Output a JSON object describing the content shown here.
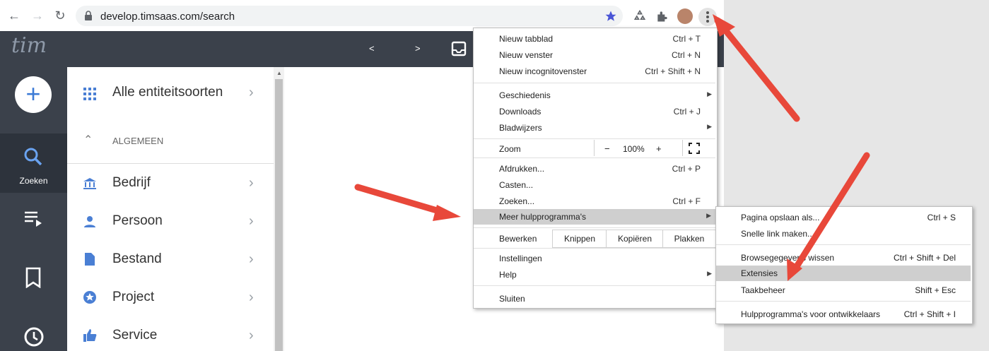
{
  "browser": {
    "url": "develop.timsaas.com/search",
    "nav": {
      "back": "←",
      "forward": "→",
      "reload": "↻"
    }
  },
  "app": {
    "logo": "tim",
    "prev": "<",
    "next": ">",
    "rail": {
      "add": "+",
      "search_label": "Zoeken"
    },
    "panel": {
      "all_types": "Alle entiteitsoorten",
      "section": "ALGEMEEN",
      "items": [
        "Bedrijf",
        "Persoon",
        "Bestand",
        "Project",
        "Service"
      ]
    }
  },
  "menu": {
    "items": [
      {
        "label": "Nieuw tabblad",
        "shortcut": "Ctrl + T"
      },
      {
        "label": "Nieuw venster",
        "shortcut": "Ctrl + N"
      },
      {
        "label": "Nieuw incognitovenster",
        "shortcut": "Ctrl + Shift + N"
      },
      {
        "label": "Geschiedenis",
        "shortcut": ""
      },
      {
        "label": "Downloads",
        "shortcut": "Ctrl + J"
      },
      {
        "label": "Bladwijzers",
        "shortcut": ""
      },
      {
        "label": "Afdrukken...",
        "shortcut": "Ctrl + P"
      },
      {
        "label": "Casten...",
        "shortcut": ""
      },
      {
        "label": "Zoeken...",
        "shortcut": "Ctrl + F"
      },
      {
        "label": "Meer hulpprogramma's",
        "shortcut": ""
      },
      {
        "label": "Instellingen",
        "shortcut": ""
      },
      {
        "label": "Help",
        "shortcut": ""
      },
      {
        "label": "Sluiten",
        "shortcut": ""
      }
    ],
    "zoom": {
      "label": "Zoom",
      "minus": "−",
      "value": "100%",
      "plus": "+"
    },
    "edit": {
      "label": "Bewerken",
      "cut": "Knippen",
      "copy": "Kopiëren",
      "paste": "Plakken"
    }
  },
  "submenu": {
    "items": [
      {
        "label": "Pagina opslaan als...",
        "shortcut": "Ctrl + S"
      },
      {
        "label": "Snelle link maken...",
        "shortcut": ""
      },
      {
        "label": "Browsegegevens wissen",
        "shortcut": "Ctrl + Shift + Del"
      },
      {
        "label": "Extensies",
        "shortcut": ""
      },
      {
        "label": "Taakbeheer",
        "shortcut": "Shift + Esc"
      },
      {
        "label": "Hulpprogramma's voor ontwikkelaars",
        "shortcut": "Ctrl + Shift + I"
      }
    ]
  },
  "colors": {
    "arrow": "#e8483a",
    "accent": "#3d7bd6",
    "menu_highlight": "#cfcfcf",
    "app_bar": "#3b414b"
  }
}
